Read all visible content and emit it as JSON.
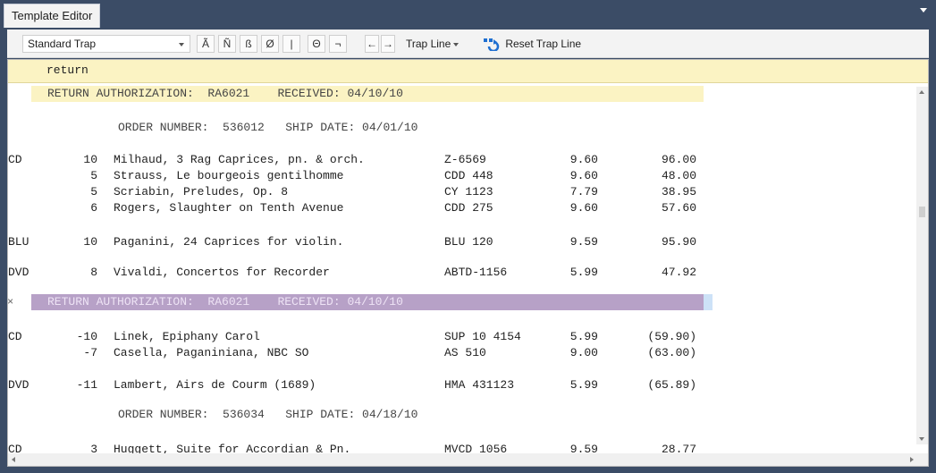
{
  "window": {
    "tab_title": "Template Editor"
  },
  "toolbar": {
    "trap_select_value": "Standard Trap",
    "buttons": [
      "Ã",
      "Ñ",
      "ß",
      "Ø",
      "|",
      "Θ",
      "¬"
    ],
    "nav_left": "←",
    "nav_right": "→",
    "trap_line_label": "Trap Line",
    "reset_label": "Reset Trap Line"
  },
  "editor": {
    "top_line": "return",
    "ra_header_1": "RETURN AUTHORIZATION:  RA6021    RECEIVED: 04/10/10",
    "order_1": "ORDER NUMBER:  536012   SHIP DATE: 04/01/10",
    "rows": [
      {
        "code": "CD",
        "qty": "10",
        "desc": "Milhaud, 3 Rag Caprices, pn. & orch.",
        "cat": "Z-6569",
        "price": "9.60",
        "total": "96.00"
      },
      {
        "code": "",
        "qty": "5",
        "desc": "Strauss, Le bourgeois gentilhomme",
        "cat": "CDD 448",
        "price": "9.60",
        "total": "48.00"
      },
      {
        "code": "",
        "qty": "5",
        "desc": "Scriabin, Preludes, Op. 8",
        "cat": "CY 1123",
        "price": "7.79",
        "total": "38.95"
      },
      {
        "code": "",
        "qty": "6",
        "desc": "Rogers, Slaughter on Tenth Avenue",
        "cat": "CDD 275",
        "price": "9.60",
        "total": "57.60"
      },
      {
        "code": "BLU",
        "qty": "10",
        "desc": "Paganini, 24 Caprices for violin.",
        "cat": "BLU 120",
        "price": "9.59",
        "total": "95.90"
      },
      {
        "code": "DVD",
        "qty": "8",
        "desc": "Vivaldi, Concertos for Recorder",
        "cat": "ABTD-1156",
        "price": "5.99",
        "total": "47.92"
      }
    ],
    "ra_header_2": "RETURN AUTHORIZATION:  RA6021    RECEIVED: 04/10/10",
    "returns": [
      {
        "code": "CD",
        "qty": "-10",
        "desc": "Linek, Epiphany Carol",
        "cat": "SUP 10 4154",
        "price": "5.99",
        "total": "(59.90)"
      },
      {
        "code": "",
        "qty": "-7",
        "desc": "Casella, Paganiniana, NBC SO",
        "cat": "AS 510",
        "price": "9.00",
        "total": "(63.00)"
      },
      {
        "code": "DVD",
        "qty": "-11",
        "desc": "Lambert, Airs de Courm (1689)",
        "cat": "HMA 431123",
        "price": "5.99",
        "total": "(65.89)"
      }
    ],
    "order_2": "ORDER NUMBER:  536034   SHIP DATE: 04/18/10",
    "last_row": {
      "code": "CD",
      "qty": "3",
      "desc": "Huggett, Suite for Accordian & Pn.",
      "cat": "MVCD 1056",
      "price": "9.59",
      "total": "28.77"
    },
    "close_mark": "×"
  },
  "colors": {
    "frame": "#3b4c66",
    "highlight_yellow": "#fbf3c3",
    "highlight_purple": "#b7a1c7",
    "purple_text": "#e9def2",
    "header_text": "#444444"
  }
}
